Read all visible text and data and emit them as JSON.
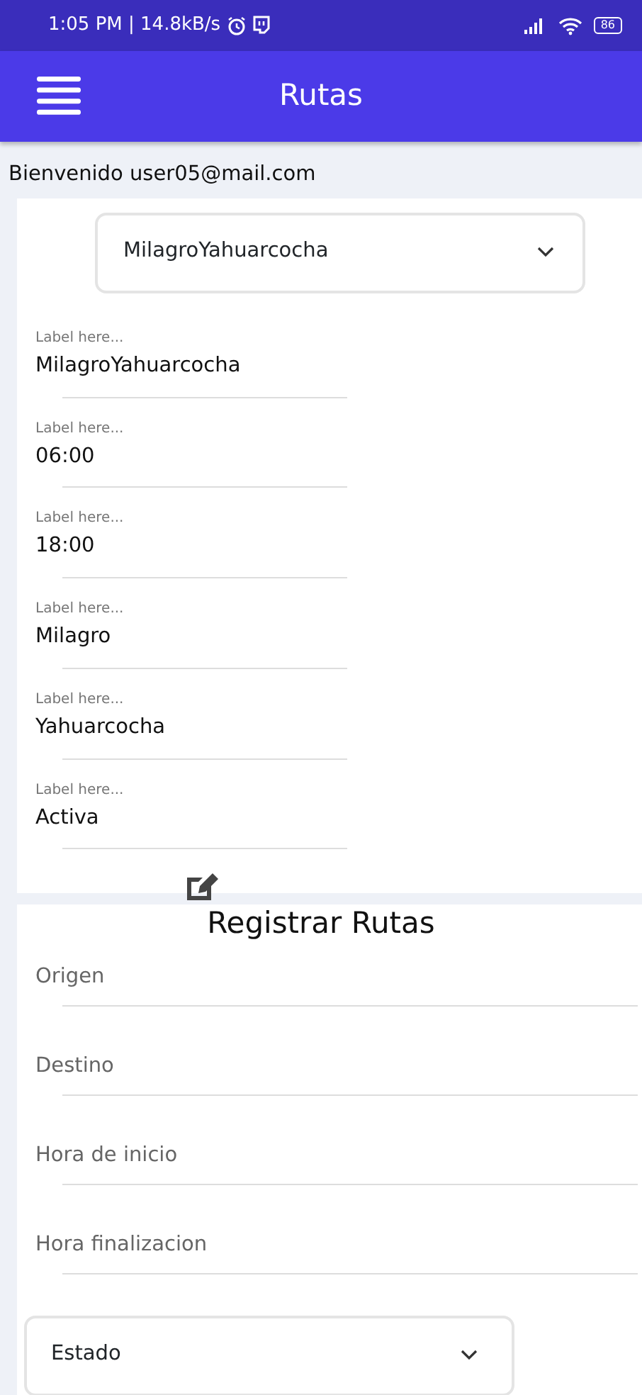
{
  "status_bar": {
    "time": "1:05 PM | 14.8kB/s",
    "battery": "86"
  },
  "app_bar": {
    "title": "Rutas"
  },
  "welcome": "Bienvenido user05@mail.com",
  "route_select": {
    "value": "MilagroYahuarcocha"
  },
  "details": [
    {
      "label": "Label here...",
      "value": "MilagroYahuarcocha"
    },
    {
      "label": "Label here...",
      "value": "06:00"
    },
    {
      "label": "Label here...",
      "value": "18:00"
    },
    {
      "label": "Label here...",
      "value": "Milagro"
    },
    {
      "label": "Label here...",
      "value": "Yahuarcocha"
    },
    {
      "label": "Label here...",
      "value": "Activa"
    }
  ],
  "form": {
    "title": "Registrar Rutas",
    "fields": [
      {
        "kind": "input",
        "placeholder": "Origen"
      },
      {
        "kind": "input",
        "placeholder": "Destino"
      },
      {
        "kind": "input",
        "placeholder": "Hora de inicio"
      },
      {
        "kind": "input",
        "placeholder": "Hora finalizacion"
      },
      {
        "kind": "select",
        "value": "Estado"
      }
    ]
  }
}
